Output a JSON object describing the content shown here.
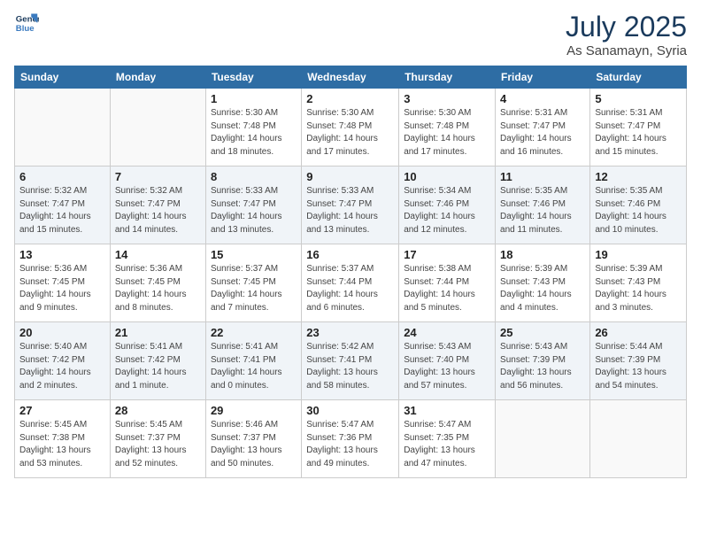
{
  "logo": {
    "line1": "General",
    "line2": "Blue"
  },
  "title": "July 2025",
  "subtitle": "As Sanamayn, Syria",
  "days_of_week": [
    "Sunday",
    "Monday",
    "Tuesday",
    "Wednesday",
    "Thursday",
    "Friday",
    "Saturday"
  ],
  "weeks": [
    [
      {
        "day": "",
        "detail": ""
      },
      {
        "day": "",
        "detail": ""
      },
      {
        "day": "1",
        "detail": "Sunrise: 5:30 AM\nSunset: 7:48 PM\nDaylight: 14 hours\nand 18 minutes."
      },
      {
        "day": "2",
        "detail": "Sunrise: 5:30 AM\nSunset: 7:48 PM\nDaylight: 14 hours\nand 17 minutes."
      },
      {
        "day": "3",
        "detail": "Sunrise: 5:30 AM\nSunset: 7:48 PM\nDaylight: 14 hours\nand 17 minutes."
      },
      {
        "day": "4",
        "detail": "Sunrise: 5:31 AM\nSunset: 7:47 PM\nDaylight: 14 hours\nand 16 minutes."
      },
      {
        "day": "5",
        "detail": "Sunrise: 5:31 AM\nSunset: 7:47 PM\nDaylight: 14 hours\nand 15 minutes."
      }
    ],
    [
      {
        "day": "6",
        "detail": "Sunrise: 5:32 AM\nSunset: 7:47 PM\nDaylight: 14 hours\nand 15 minutes."
      },
      {
        "day": "7",
        "detail": "Sunrise: 5:32 AM\nSunset: 7:47 PM\nDaylight: 14 hours\nand 14 minutes."
      },
      {
        "day": "8",
        "detail": "Sunrise: 5:33 AM\nSunset: 7:47 PM\nDaylight: 14 hours\nand 13 minutes."
      },
      {
        "day": "9",
        "detail": "Sunrise: 5:33 AM\nSunset: 7:47 PM\nDaylight: 14 hours\nand 13 minutes."
      },
      {
        "day": "10",
        "detail": "Sunrise: 5:34 AM\nSunset: 7:46 PM\nDaylight: 14 hours\nand 12 minutes."
      },
      {
        "day": "11",
        "detail": "Sunrise: 5:35 AM\nSunset: 7:46 PM\nDaylight: 14 hours\nand 11 minutes."
      },
      {
        "day": "12",
        "detail": "Sunrise: 5:35 AM\nSunset: 7:46 PM\nDaylight: 14 hours\nand 10 minutes."
      }
    ],
    [
      {
        "day": "13",
        "detail": "Sunrise: 5:36 AM\nSunset: 7:45 PM\nDaylight: 14 hours\nand 9 minutes."
      },
      {
        "day": "14",
        "detail": "Sunrise: 5:36 AM\nSunset: 7:45 PM\nDaylight: 14 hours\nand 8 minutes."
      },
      {
        "day": "15",
        "detail": "Sunrise: 5:37 AM\nSunset: 7:45 PM\nDaylight: 14 hours\nand 7 minutes."
      },
      {
        "day": "16",
        "detail": "Sunrise: 5:37 AM\nSunset: 7:44 PM\nDaylight: 14 hours\nand 6 minutes."
      },
      {
        "day": "17",
        "detail": "Sunrise: 5:38 AM\nSunset: 7:44 PM\nDaylight: 14 hours\nand 5 minutes."
      },
      {
        "day": "18",
        "detail": "Sunrise: 5:39 AM\nSunset: 7:43 PM\nDaylight: 14 hours\nand 4 minutes."
      },
      {
        "day": "19",
        "detail": "Sunrise: 5:39 AM\nSunset: 7:43 PM\nDaylight: 14 hours\nand 3 minutes."
      }
    ],
    [
      {
        "day": "20",
        "detail": "Sunrise: 5:40 AM\nSunset: 7:42 PM\nDaylight: 14 hours\nand 2 minutes."
      },
      {
        "day": "21",
        "detail": "Sunrise: 5:41 AM\nSunset: 7:42 PM\nDaylight: 14 hours\nand 1 minute."
      },
      {
        "day": "22",
        "detail": "Sunrise: 5:41 AM\nSunset: 7:41 PM\nDaylight: 14 hours\nand 0 minutes."
      },
      {
        "day": "23",
        "detail": "Sunrise: 5:42 AM\nSunset: 7:41 PM\nDaylight: 13 hours\nand 58 minutes."
      },
      {
        "day": "24",
        "detail": "Sunrise: 5:43 AM\nSunset: 7:40 PM\nDaylight: 13 hours\nand 57 minutes."
      },
      {
        "day": "25",
        "detail": "Sunrise: 5:43 AM\nSunset: 7:39 PM\nDaylight: 13 hours\nand 56 minutes."
      },
      {
        "day": "26",
        "detail": "Sunrise: 5:44 AM\nSunset: 7:39 PM\nDaylight: 13 hours\nand 54 minutes."
      }
    ],
    [
      {
        "day": "27",
        "detail": "Sunrise: 5:45 AM\nSunset: 7:38 PM\nDaylight: 13 hours\nand 53 minutes."
      },
      {
        "day": "28",
        "detail": "Sunrise: 5:45 AM\nSunset: 7:37 PM\nDaylight: 13 hours\nand 52 minutes."
      },
      {
        "day": "29",
        "detail": "Sunrise: 5:46 AM\nSunset: 7:37 PM\nDaylight: 13 hours\nand 50 minutes."
      },
      {
        "day": "30",
        "detail": "Sunrise: 5:47 AM\nSunset: 7:36 PM\nDaylight: 13 hours\nand 49 minutes."
      },
      {
        "day": "31",
        "detail": "Sunrise: 5:47 AM\nSunset: 7:35 PM\nDaylight: 13 hours\nand 47 minutes."
      },
      {
        "day": "",
        "detail": ""
      },
      {
        "day": "",
        "detail": ""
      }
    ]
  ]
}
